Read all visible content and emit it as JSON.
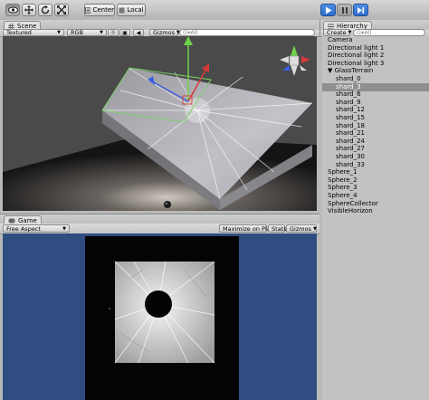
{
  "toolbar": {
    "tools": [
      "hand-tool",
      "move-tool",
      "rotate-tool",
      "scale-tool"
    ],
    "pivot_label": "Center",
    "space_label": "Local",
    "play_colors": {
      "active": "#3b7ddd"
    }
  },
  "scene": {
    "tab_label": "Scene",
    "render_mode": "Textured",
    "color_mode": "RGB",
    "gizmos_label": "Gizmos",
    "search_placeholder": "G▾All"
  },
  "hierarchy": {
    "tab_label": "Hierarchy",
    "create_label": "Create",
    "search_placeholder": "G▾All",
    "items": [
      {
        "label": "Camera",
        "indent": 0
      },
      {
        "label": "Directional light 1",
        "indent": 0
      },
      {
        "label": "Directional light 2",
        "indent": 0
      },
      {
        "label": "Directional light 3",
        "indent": 0
      },
      {
        "label": "▼ GlassTerrain",
        "indent": 0
      },
      {
        "label": "shard_0",
        "indent": 1
      },
      {
        "label": "shard_3",
        "indent": 1,
        "selected": true
      },
      {
        "label": "shard_6",
        "indent": 1
      },
      {
        "label": "shard_9",
        "indent": 1
      },
      {
        "label": "shard_12",
        "indent": 1
      },
      {
        "label": "shard_15",
        "indent": 1
      },
      {
        "label": "shard_18",
        "indent": 1
      },
      {
        "label": "shard_21",
        "indent": 1
      },
      {
        "label": "shard_24",
        "indent": 1
      },
      {
        "label": "shard_27",
        "indent": 1
      },
      {
        "label": "shard_30",
        "indent": 1
      },
      {
        "label": "shard_33",
        "indent": 1
      },
      {
        "label": "Sphere_1",
        "indent": 0
      },
      {
        "label": "Sphere_2",
        "indent": 0
      },
      {
        "label": "Sphere_3",
        "indent": 0
      },
      {
        "label": "Sphere_4",
        "indent": 0
      },
      {
        "label": "SphereCollector",
        "indent": 0
      },
      {
        "label": "VisibleHorizon",
        "indent": 0
      }
    ]
  },
  "game": {
    "tab_label": "Game",
    "aspect_label": "Free Aspect",
    "maximize_label": "Maximize on Play",
    "stats_label": "Stats",
    "gizmos_label": "Gizmos"
  },
  "colors": {
    "game_bg": "#2f4d80",
    "selection": "#8f8f8f",
    "scene_bg": "#4b4b4b"
  }
}
